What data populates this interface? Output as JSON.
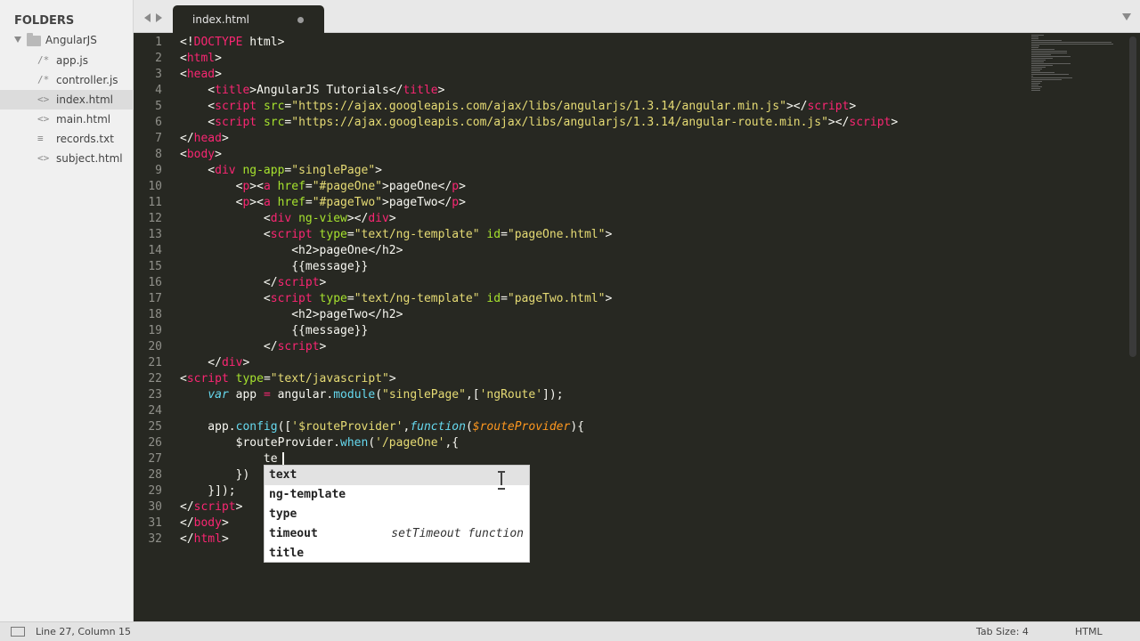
{
  "sidebar": {
    "title": "FOLDERS",
    "folder": "AngularJS",
    "files": [
      {
        "name": "app.js",
        "icon": "/*"
      },
      {
        "name": "controller.js",
        "icon": "/*"
      },
      {
        "name": "index.html",
        "icon": "<>"
      },
      {
        "name": "main.html",
        "icon": "<>"
      },
      {
        "name": "records.txt",
        "icon": "≡"
      },
      {
        "name": "subject.html",
        "icon": "<>"
      }
    ],
    "active_index": 2
  },
  "tab": {
    "label": "index.html"
  },
  "editor": {
    "line_numbers": [
      "1",
      "2",
      "3",
      "4",
      "5",
      "6",
      "7",
      "8",
      "9",
      "10",
      "11",
      "12",
      "13",
      "14",
      "15",
      "16",
      "17",
      "18",
      "19",
      "20",
      "21",
      "22",
      "23",
      "24",
      "25",
      "26",
      "27",
      "28",
      "29",
      "30",
      "31",
      "32"
    ],
    "lines": [
      [
        [
          "d",
          "<!"
        ],
        [
          "t",
          "DOCTYPE"
        ],
        [
          "d",
          " html>"
        ]
      ],
      [
        [
          "d",
          "<"
        ],
        [
          "t",
          "html"
        ],
        [
          "d",
          ">"
        ]
      ],
      [
        [
          "d",
          "<"
        ],
        [
          "t",
          "head"
        ],
        [
          "d",
          ">"
        ]
      ],
      [
        [
          "d",
          "    <"
        ],
        [
          "t",
          "title"
        ],
        [
          "d",
          ">AngularJS Tutorials</"
        ],
        [
          "t",
          "title"
        ],
        [
          "d",
          ">"
        ]
      ],
      [
        [
          "d",
          "    <"
        ],
        [
          "t",
          "script"
        ],
        [
          "d",
          " "
        ],
        [
          "a",
          "src"
        ],
        [
          "d",
          "="
        ],
        [
          "s",
          "\"https://ajax.googleapis.com/ajax/libs/angularjs/1.3.14/angular.min.js\""
        ],
        [
          "d",
          "></"
        ],
        [
          "t",
          "script"
        ],
        [
          "d",
          ">"
        ]
      ],
      [
        [
          "d",
          "    <"
        ],
        [
          "t",
          "script"
        ],
        [
          "d",
          " "
        ],
        [
          "a",
          "src"
        ],
        [
          "d",
          "="
        ],
        [
          "s",
          "\"https://ajax.googleapis.com/ajax/libs/angularjs/1.3.14/angular-route.min.js\""
        ],
        [
          "d",
          "></"
        ],
        [
          "t",
          "script"
        ],
        [
          "d",
          ">"
        ]
      ],
      [
        [
          "d",
          "</"
        ],
        [
          "t",
          "head"
        ],
        [
          "d",
          ">"
        ]
      ],
      [
        [
          "d",
          "<"
        ],
        [
          "t",
          "body"
        ],
        [
          "d",
          ">"
        ]
      ],
      [
        [
          "d",
          "    <"
        ],
        [
          "t",
          "div"
        ],
        [
          "d",
          " "
        ],
        [
          "a",
          "ng-app"
        ],
        [
          "d",
          "="
        ],
        [
          "s",
          "\"singlePage\""
        ],
        [
          "d",
          ">"
        ]
      ],
      [
        [
          "d",
          "        <"
        ],
        [
          "t",
          "p"
        ],
        [
          "d",
          "><"
        ],
        [
          "t",
          "a"
        ],
        [
          "d",
          " "
        ],
        [
          "a",
          "href"
        ],
        [
          "d",
          "="
        ],
        [
          "s",
          "\"#pageOne\""
        ],
        [
          "d",
          ">pageOne</"
        ],
        [
          "t",
          "p"
        ],
        [
          "d",
          ">"
        ]
      ],
      [
        [
          "d",
          "        <"
        ],
        [
          "t",
          "p"
        ],
        [
          "d",
          "><"
        ],
        [
          "t",
          "a"
        ],
        [
          "d",
          " "
        ],
        [
          "a",
          "href"
        ],
        [
          "d",
          "="
        ],
        [
          "s",
          "\"#pageTwo\""
        ],
        [
          "d",
          ">pageTwo</"
        ],
        [
          "t",
          "p"
        ],
        [
          "d",
          ">"
        ]
      ],
      [
        [
          "d",
          "            <"
        ],
        [
          "t",
          "div"
        ],
        [
          "d",
          " "
        ],
        [
          "a",
          "ng-view"
        ],
        [
          "d",
          "></"
        ],
        [
          "t",
          "div"
        ],
        [
          "d",
          ">"
        ]
      ],
      [
        [
          "d",
          "            <"
        ],
        [
          "t",
          "script"
        ],
        [
          "d",
          " "
        ],
        [
          "a",
          "type"
        ],
        [
          "d",
          "="
        ],
        [
          "s",
          "\"text/ng-template\""
        ],
        [
          "d",
          " "
        ],
        [
          "a",
          "id"
        ],
        [
          "d",
          "="
        ],
        [
          "s",
          "\"pageOne.html\""
        ],
        [
          "d",
          ">"
        ]
      ],
      [
        [
          "d",
          "                <h2>pageOne</h2>"
        ]
      ],
      [
        [
          "d",
          "                {{message}}"
        ]
      ],
      [
        [
          "d",
          "            </"
        ],
        [
          "t",
          "script"
        ],
        [
          "d",
          ">"
        ]
      ],
      [
        [
          "d",
          "            <"
        ],
        [
          "t",
          "script"
        ],
        [
          "d",
          " "
        ],
        [
          "a",
          "type"
        ],
        [
          "d",
          "="
        ],
        [
          "s",
          "\"text/ng-template\""
        ],
        [
          "d",
          " "
        ],
        [
          "a",
          "id"
        ],
        [
          "d",
          "="
        ],
        [
          "s",
          "\"pageTwo.html\""
        ],
        [
          "d",
          ">"
        ]
      ],
      [
        [
          "d",
          "                <h2>pageTwo</h2>"
        ]
      ],
      [
        [
          "d",
          "                {{message}}"
        ]
      ],
      [
        [
          "d",
          "            </"
        ],
        [
          "t",
          "script"
        ],
        [
          "d",
          ">"
        ]
      ],
      [
        [
          "d",
          "    </"
        ],
        [
          "t",
          "div"
        ],
        [
          "d",
          ">"
        ]
      ],
      [
        [
          "d",
          "<"
        ],
        [
          "t",
          "script"
        ],
        [
          "d",
          " "
        ],
        [
          "a",
          "type"
        ],
        [
          "d",
          "="
        ],
        [
          "s",
          "\"text/javascript\""
        ],
        [
          "d",
          ">"
        ]
      ],
      [
        [
          "d",
          "    "
        ],
        [
          "k",
          "var"
        ],
        [
          "d",
          " app "
        ],
        [
          "t",
          "="
        ],
        [
          "d",
          " angular."
        ],
        [
          "f",
          "module"
        ],
        [
          "d",
          "("
        ],
        [
          "s",
          "\"singlePage\""
        ],
        [
          "d",
          ",["
        ],
        [
          "s",
          "'ngRoute'"
        ],
        [
          "d",
          "]);"
        ]
      ],
      [
        [
          "d",
          ""
        ]
      ],
      [
        [
          "d",
          "    app."
        ],
        [
          "f",
          "config"
        ],
        [
          "d",
          "(["
        ],
        [
          "s",
          "'$routeProvider'"
        ],
        [
          "d",
          ","
        ],
        [
          "k",
          "function"
        ],
        [
          "d",
          "("
        ],
        [
          "p",
          "$routeProvider"
        ],
        [
          "d",
          "){"
        ]
      ],
      [
        [
          "d",
          "        $routeProvider."
        ],
        [
          "f",
          "when"
        ],
        [
          "d",
          "("
        ],
        [
          "s",
          "'/pageOne'"
        ],
        [
          "d",
          ",{"
        ]
      ],
      [
        [
          "d",
          "            te"
        ]
      ],
      [
        [
          "d",
          "        })"
        ]
      ],
      [
        [
          "d",
          "    }]);"
        ]
      ],
      [
        [
          "d",
          "</"
        ],
        [
          "t",
          "script"
        ],
        [
          "d",
          ">"
        ]
      ],
      [
        [
          "d",
          "</"
        ],
        [
          "t",
          "body"
        ],
        [
          "d",
          ">"
        ]
      ],
      [
        [
          "d",
          "</"
        ],
        [
          "t",
          "html"
        ],
        [
          "d",
          ">"
        ]
      ]
    ]
  },
  "autocomplete": {
    "items": [
      {
        "bold": "te",
        "rest": "xt",
        "hint": ""
      },
      {
        "pre": "ng-",
        "bold": "te",
        "rest": "mplate",
        "hint": ""
      },
      {
        "bold": "t",
        "rest": "yp",
        "tail": "e",
        "hint": ""
      },
      {
        "bold": "t",
        "rest": "im",
        "tail": "eout",
        "hint": "setTimeout function"
      },
      {
        "bold": "t",
        "rest": "itl",
        "tail": "e",
        "hint": ""
      }
    ],
    "labels": [
      "text",
      "ng-template",
      "type",
      "timeout",
      "title"
    ]
  },
  "status": {
    "position": "Line 27, Column 15",
    "tab_size": "Tab Size: 4",
    "syntax": "HTML"
  },
  "colors": {
    "editor_bg": "#272822",
    "tag": "#f92672",
    "attribute": "#a6e22e",
    "string": "#e6db74",
    "keyword": "#66d9ef",
    "param": "#fd971f"
  }
}
